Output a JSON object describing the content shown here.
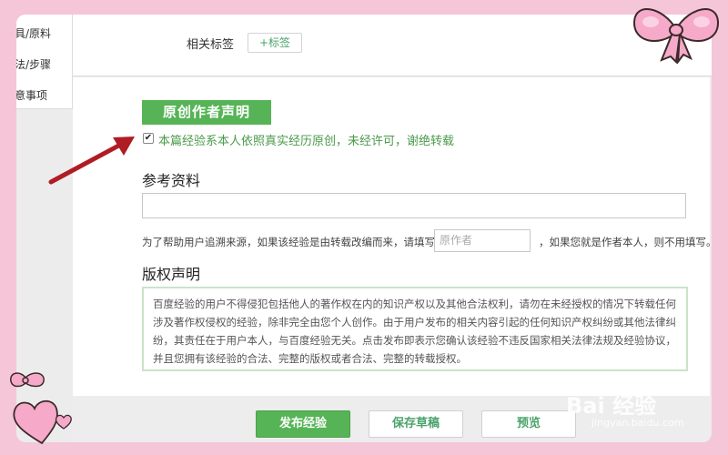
{
  "nav": {
    "items": [
      "工具/原料",
      "方法/步骤",
      "注意事项"
    ]
  },
  "tags": {
    "label": "相关标签",
    "add_button": "+标签"
  },
  "original_declaration": {
    "badge": "原创作者声明",
    "checkbox_checked": true,
    "checkbox_text": "本篇经验系本人依照真实经历原创，未经许可，谢绝转载"
  },
  "references": {
    "title": "参考资料",
    "input_value": "",
    "hint_before": "为了帮助用户追溯来源，如果该经验是由转载改编而来，请填写",
    "author_placeholder": "原作者",
    "hint_after": "，如果您就是作者本人，则不用填写。"
  },
  "copyright": {
    "title": "版权声明",
    "text": "百度经验的用户不得侵犯包括他人的著作权在内的知识产权以及其他合法权利，请勿在未经授权的情况下转载任何涉及著作权侵权的经验，除非完全由您个人创作。由于用户发布的相关内容引起的任何知识产权纠纷或其他法律纠纷，其责任在于用户本人，与百度经验无关。点击发布即表示您确认该经验不违反国家相关法律法规及经验协议，并且您拥有该经验的合法、完整的版权或者合法、完整的转载授权。"
  },
  "actions": {
    "publish": "发布经验",
    "save_draft": "保存草稿",
    "preview": "预览"
  },
  "watermark": {
    "brand": "Bai 经验",
    "url": "jingyan.baidu.com"
  },
  "colors": {
    "accent_green": "#56b456",
    "background_pink": "#f5c6d8",
    "annotation_arrow": "#b01c24"
  }
}
